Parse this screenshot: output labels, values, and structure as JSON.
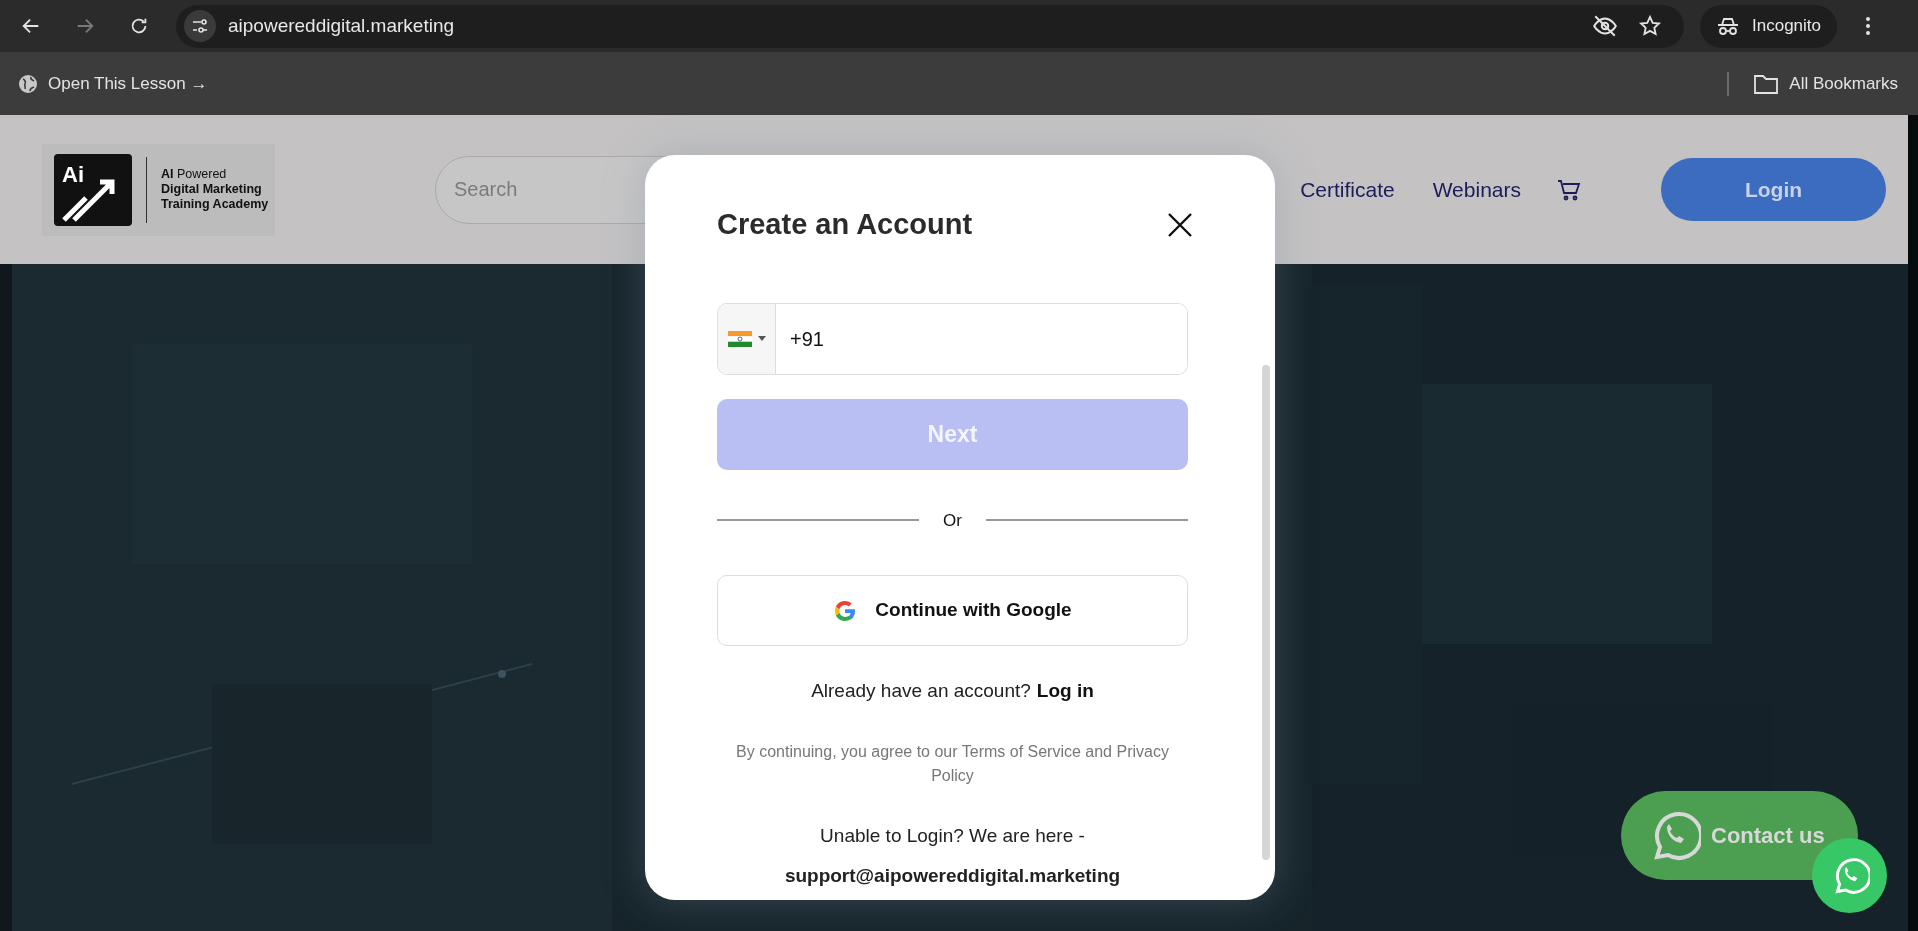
{
  "browser": {
    "url": "aipowereddigital.marketing",
    "incognito_label": "Incognito",
    "bookmarks": [
      {
        "label": "Open This Lesson →"
      }
    ],
    "all_bookmarks": "All Bookmarks"
  },
  "site_header": {
    "logo": {
      "mark": "Ai",
      "line_1": "**AI** Powered",
      "line_2": "Digital Marketing",
      "line_3": "Training Academy"
    },
    "search": {
      "placeholder": "Search"
    },
    "nav": [
      "Certificate",
      "Webinars"
    ],
    "login": "Login"
  },
  "modal": {
    "title": "Create an Account",
    "phone": {
      "value": "+91"
    },
    "next_button": {
      "label": "Next",
      "disabled": true
    },
    "divider": "Or",
    "google_button": "Continue with Google",
    "login_prompt": {
      "text": "Already have an account?",
      "link": "Log in"
    },
    "terms": "By continuing, you agree to our Terms of Service and Privacy Policy",
    "help": "Unable to Login? We are here -",
    "email": "support@aipowereddigital.marketing"
  },
  "contact": {
    "label": "Contact us"
  }
}
